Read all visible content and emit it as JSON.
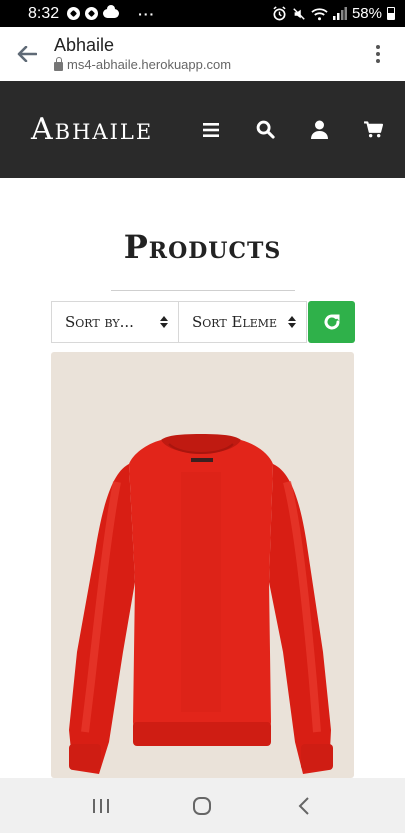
{
  "status_bar": {
    "time": "8:32",
    "dots": "···",
    "battery": "58%"
  },
  "browser": {
    "title": "Abhaile",
    "url": "ms4-abhaile.herokuapp.com"
  },
  "site": {
    "brand": "Abhaile",
    "nav_icons": [
      "hamburger-menu-icon",
      "search-icon",
      "user-icon",
      "cart-icon"
    ]
  },
  "products": {
    "title": "Products",
    "sort_by": "Sort by...",
    "sort_element": "Sort Eleme",
    "reset_icon": "refresh-icon",
    "accent_color": "#2fb14a"
  },
  "product_card": {
    "image": "red-sweater",
    "background_color": "#eae2d9"
  },
  "android_nav": {
    "icons": [
      "recent-apps-icon",
      "home-icon",
      "back-icon"
    ]
  }
}
